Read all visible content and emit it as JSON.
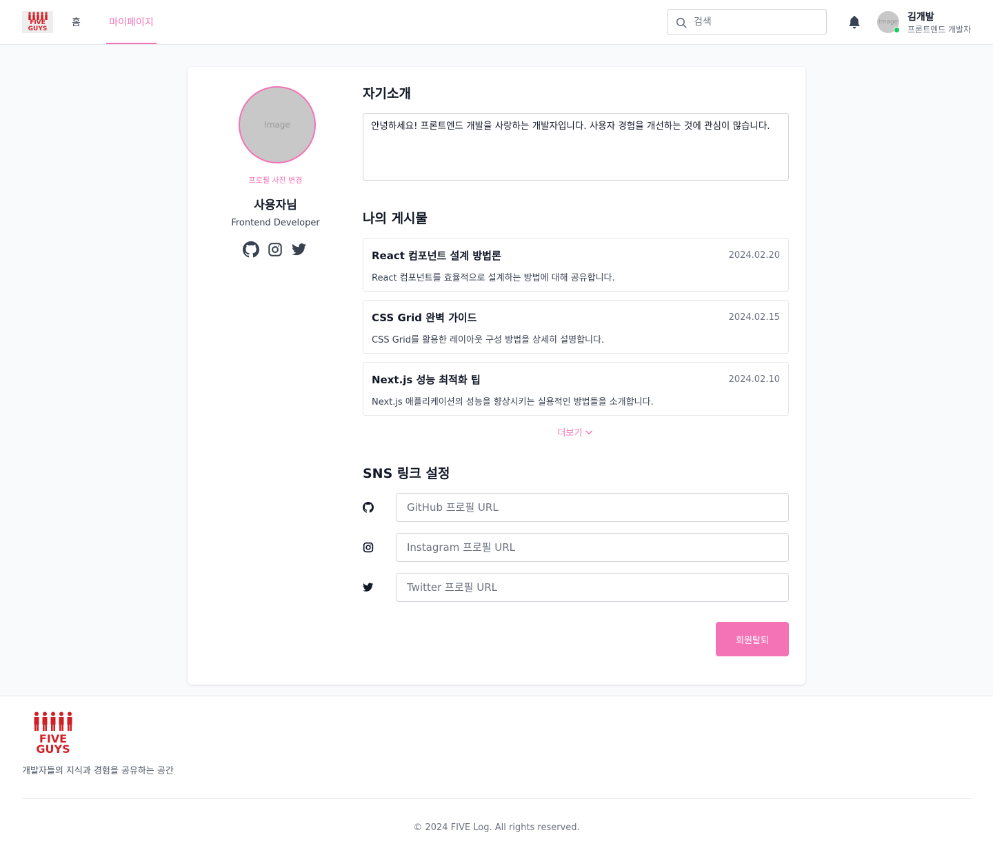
{
  "brand": {
    "logo_line1": "FIVE",
    "logo_line2": "GUYS",
    "color": "#d21f26"
  },
  "nav": {
    "home": "홈",
    "mypage": "마이페이지",
    "active": "마이페이지"
  },
  "search": {
    "placeholder": "검색"
  },
  "user": {
    "avatar_text": "Image",
    "name": "김개발",
    "role": "프론트엔드 개발자",
    "status": "online"
  },
  "profile": {
    "image_text": "Image",
    "change_photo": "프로필 사진 변경",
    "name": "사용자님",
    "title": "Frontend Developer",
    "social_icons": [
      "github-icon",
      "instagram-icon",
      "twitter-icon"
    ]
  },
  "about": {
    "title": "자기소개",
    "text": "안녕하세요! 프론트엔드 개발을 사랑하는 개발자입니다. 사용자 경험을 개선하는 것에 관심이 많습니다."
  },
  "posts": {
    "title": "나의 게시물",
    "items": [
      {
        "title": "React 컴포넌트 설계 방법론",
        "date": "2024.02.20",
        "desc": "React 컴포넌트를 효율적으로 설계하는 방법에 대해 공유합니다."
      },
      {
        "title": "CSS Grid 완벽 가이드",
        "date": "2024.02.15",
        "desc": "CSS Grid를 활용한 레이아웃 구성 방법을 상세히 설명합니다."
      },
      {
        "title": "Next.js 성능 최적화 팁",
        "date": "2024.02.10",
        "desc": "Next.js 애플리케이션의 성능을 향상시키는 실용적인 방법들을 소개합니다."
      }
    ],
    "more": "더보기"
  },
  "sns": {
    "title": "SNS 링크 설정",
    "github": {
      "placeholder": "GitHub 프로필 URL",
      "value": ""
    },
    "instagram": {
      "placeholder": "Instagram 프로필 URL",
      "value": ""
    },
    "twitter": {
      "placeholder": "Twitter 프로필 URL",
      "value": ""
    }
  },
  "withdraw": "회원탈퇴",
  "footer": {
    "tagline": "개발자들의 지식과 경험을 공유하는 공간",
    "copyright": "© 2024 FIVE Log. All rights reserved."
  },
  "colors": {
    "accent": "#f472b6",
    "online": "#22c55e",
    "icon": "#374151"
  }
}
